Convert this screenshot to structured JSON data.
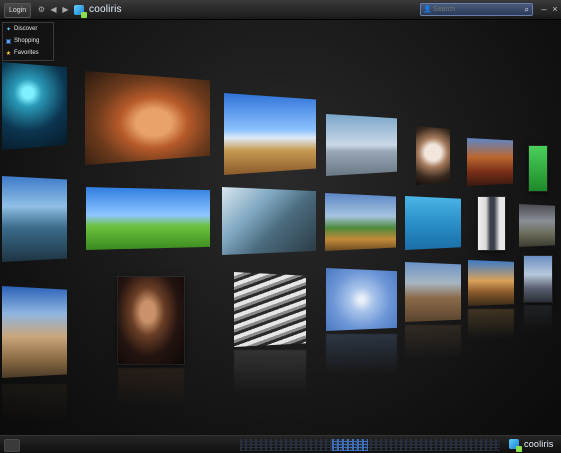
{
  "topbar": {
    "login_label": "Login",
    "brand": "cooliris",
    "search_placeholder": "Search",
    "icons": [
      "gear-icon",
      "back-arrow-icon",
      "forward-arrow-icon",
      "search-icon",
      "minimize-icon",
      "close-icon"
    ]
  },
  "menu": {
    "items": [
      {
        "label": "Discover",
        "icon": "discover-icon",
        "color": "#6ec3ff"
      },
      {
        "label": "Shopping",
        "icon": "shopping-icon",
        "color": "#5aa0ff"
      },
      {
        "label": "Favorites",
        "icon": "star-icon",
        "color": "#ffcc33"
      }
    ]
  },
  "bottombar": {
    "brand": "cooliris"
  },
  "colors": {
    "accent": "#3d6fb8",
    "brand_blue": "#1e7fd6",
    "brand_green": "#8be04a"
  }
}
